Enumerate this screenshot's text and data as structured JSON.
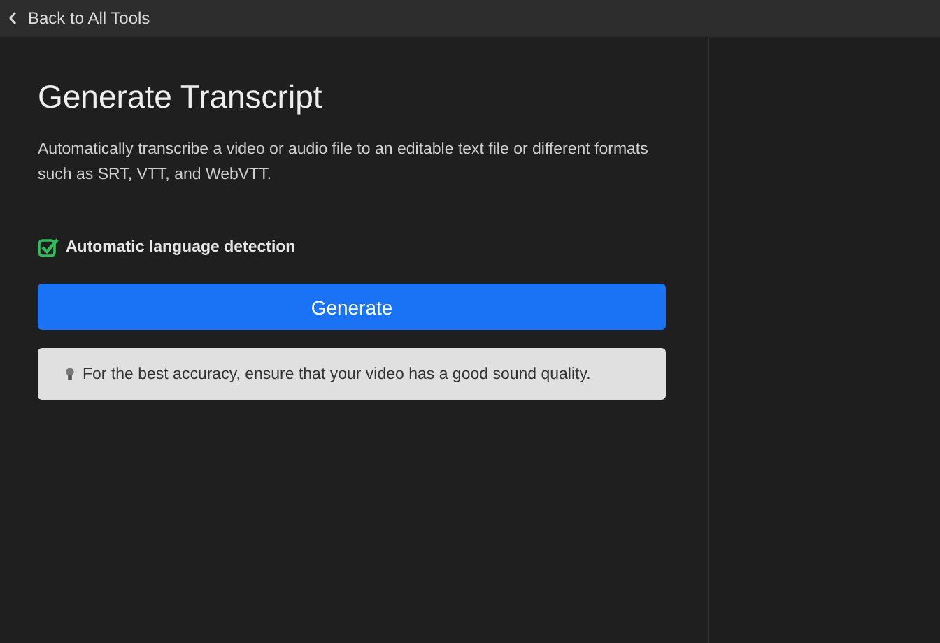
{
  "top_bar": {
    "back_link": "Back to All Tools"
  },
  "panel": {
    "title": "Generate Transcript",
    "description": "Automatically transcribe a video or audio file to an editable text file or different formats such as SRT, VTT, and WebVTT.",
    "option": {
      "label": "Automatic language detection",
      "checked": true
    },
    "button": "Generate",
    "tip": "For the best accuracy, ensure that your video has a good sound quality."
  }
}
